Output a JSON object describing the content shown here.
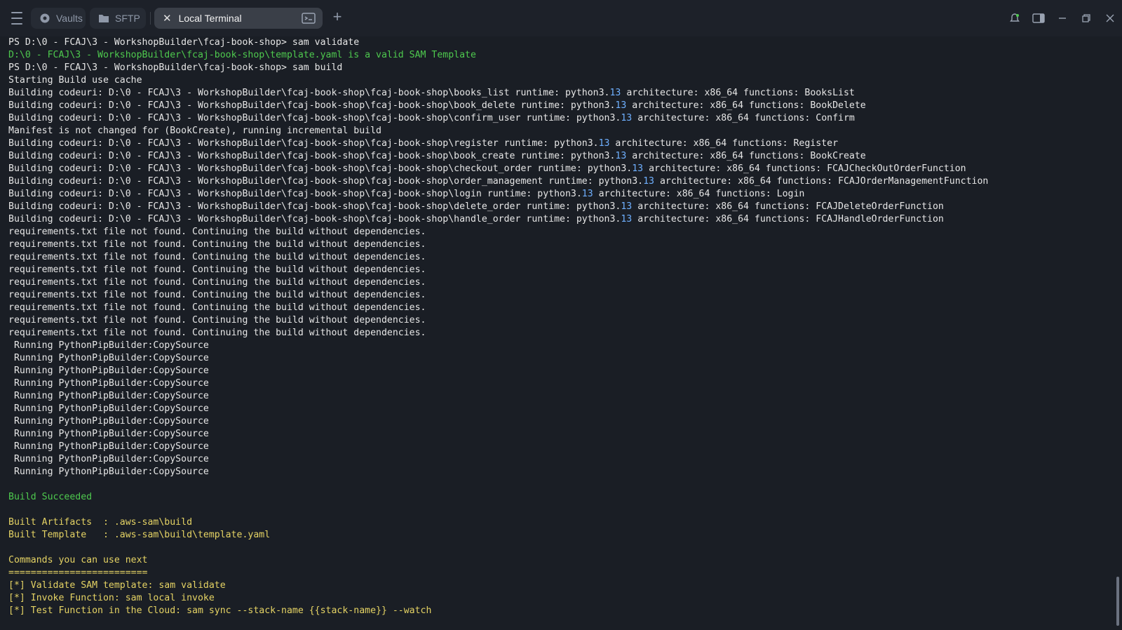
{
  "tabs": {
    "vaults_label": "Vaults",
    "sftp_label": "SFTP",
    "local_label": "Local Terminal"
  },
  "colors": {
    "background": "#1a1e25",
    "success_green": "#4ec94e",
    "info_yellow": "#e5d364",
    "number_blue": "#6fb0ff"
  },
  "terminal": {
    "lines": [
      {
        "text": "PS D:\\0 - FCAJ\\3 - WorkshopBuilder\\fcaj-book-shop> sam validate",
        "style": "plain"
      },
      {
        "text": "D:\\0 - FCAJ\\3 - WorkshopBuilder\\fcaj-book-shop\\template.yaml is a valid SAM Template",
        "style": "green"
      },
      {
        "text": "PS D:\\0 - FCAJ\\3 - WorkshopBuilder\\fcaj-book-shop> sam build",
        "style": "plain"
      },
      {
        "text": "Starting Build use cache",
        "style": "plain"
      },
      {
        "text": "Building codeuri: D:\\0 - FCAJ\\3 - WorkshopBuilder\\fcaj-book-shop\\fcaj-book-shop\\books_list runtime: python3.13 architecture: x86_64 functions: BooksList",
        "style": "plain"
      },
      {
        "text": "Building codeuri: D:\\0 - FCAJ\\3 - WorkshopBuilder\\fcaj-book-shop\\fcaj-book-shop\\book_delete runtime: python3.13 architecture: x86_64 functions: BookDelete",
        "style": "plain"
      },
      {
        "text": "Building codeuri: D:\\0 - FCAJ\\3 - WorkshopBuilder\\fcaj-book-shop\\fcaj-book-shop\\confirm_user runtime: python3.13 architecture: x86_64 functions: Confirm",
        "style": "plain"
      },
      {
        "text": "Manifest is not changed for (BookCreate), running incremental build",
        "style": "plain"
      },
      {
        "text": "Building codeuri: D:\\0 - FCAJ\\3 - WorkshopBuilder\\fcaj-book-shop\\fcaj-book-shop\\register runtime: python3.13 architecture: x86_64 functions: Register",
        "style": "plain"
      },
      {
        "text": "Building codeuri: D:\\0 - FCAJ\\3 - WorkshopBuilder\\fcaj-book-shop\\fcaj-book-shop\\book_create runtime: python3.13 architecture: x86_64 functions: BookCreate",
        "style": "plain"
      },
      {
        "text": "Building codeuri: D:\\0 - FCAJ\\3 - WorkshopBuilder\\fcaj-book-shop\\fcaj-book-shop\\checkout_order runtime: python3.13 architecture: x86_64 functions: FCAJCheckOutOrderFunction",
        "style": "plain"
      },
      {
        "text": "Building codeuri: D:\\0 - FCAJ\\3 - WorkshopBuilder\\fcaj-book-shop\\fcaj-book-shop\\order_management runtime: python3.13 architecture: x86_64 functions: FCAJOrderManagementFunction",
        "style": "plain"
      },
      {
        "text": "Building codeuri: D:\\0 - FCAJ\\3 - WorkshopBuilder\\fcaj-book-shop\\fcaj-book-shop\\login runtime: python3.13 architecture: x86_64 functions: Login",
        "style": "plain"
      },
      {
        "text": "Building codeuri: D:\\0 - FCAJ\\3 - WorkshopBuilder\\fcaj-book-shop\\fcaj-book-shop\\delete_order runtime: python3.13 architecture: x86_64 functions: FCAJDeleteOrderFunction",
        "style": "plain"
      },
      {
        "text": "Building codeuri: D:\\0 - FCAJ\\3 - WorkshopBuilder\\fcaj-book-shop\\fcaj-book-shop\\handle_order runtime: python3.13 architecture: x86_64 functions: FCAJHandleOrderFunction",
        "style": "plain"
      },
      {
        "text": "requirements.txt file not found. Continuing the build without dependencies.",
        "style": "plain"
      },
      {
        "text": "requirements.txt file not found. Continuing the build without dependencies.",
        "style": "plain"
      },
      {
        "text": "requirements.txt file not found. Continuing the build without dependencies.",
        "style": "plain"
      },
      {
        "text": "requirements.txt file not found. Continuing the build without dependencies.",
        "style": "plain"
      },
      {
        "text": "requirements.txt file not found. Continuing the build without dependencies.",
        "style": "plain"
      },
      {
        "text": "requirements.txt file not found. Continuing the build without dependencies.",
        "style": "plain"
      },
      {
        "text": "requirements.txt file not found. Continuing the build without dependencies.",
        "style": "plain"
      },
      {
        "text": "requirements.txt file not found. Continuing the build without dependencies.",
        "style": "plain"
      },
      {
        "text": "requirements.txt file not found. Continuing the build without dependencies.",
        "style": "plain"
      },
      {
        "text": " Running PythonPipBuilder:CopySource",
        "style": "plain"
      },
      {
        "text": " Running PythonPipBuilder:CopySource",
        "style": "plain"
      },
      {
        "text": " Running PythonPipBuilder:CopySource",
        "style": "plain"
      },
      {
        "text": " Running PythonPipBuilder:CopySource",
        "style": "plain"
      },
      {
        "text": " Running PythonPipBuilder:CopySource",
        "style": "plain"
      },
      {
        "text": " Running PythonPipBuilder:CopySource",
        "style": "plain"
      },
      {
        "text": " Running PythonPipBuilder:CopySource",
        "style": "plain"
      },
      {
        "text": " Running PythonPipBuilder:CopySource",
        "style": "plain"
      },
      {
        "text": " Running PythonPipBuilder:CopySource",
        "style": "plain"
      },
      {
        "text": " Running PythonPipBuilder:CopySource",
        "style": "plain"
      },
      {
        "text": " Running PythonPipBuilder:CopySource",
        "style": "plain"
      },
      {
        "text": "",
        "style": "plain"
      },
      {
        "text": "Build Succeeded",
        "style": "green"
      },
      {
        "text": "",
        "style": "plain"
      },
      {
        "text": "Built Artifacts  : .aws-sam\\build",
        "style": "yellow"
      },
      {
        "text": "Built Template   : .aws-sam\\build\\template.yaml",
        "style": "yellow"
      },
      {
        "text": "",
        "style": "plain"
      },
      {
        "text": "Commands you can use next",
        "style": "yellow"
      },
      {
        "text": "=========================",
        "style": "yellow"
      },
      {
        "text": "[*] Validate SAM template: sam validate",
        "style": "yellow"
      },
      {
        "text": "[*] Invoke Function: sam local invoke",
        "style": "yellow"
      },
      {
        "text": "[*] Test Function in the Cloud: sam sync --stack-name {{stack-name}} --watch",
        "style": "yellow"
      }
    ]
  }
}
